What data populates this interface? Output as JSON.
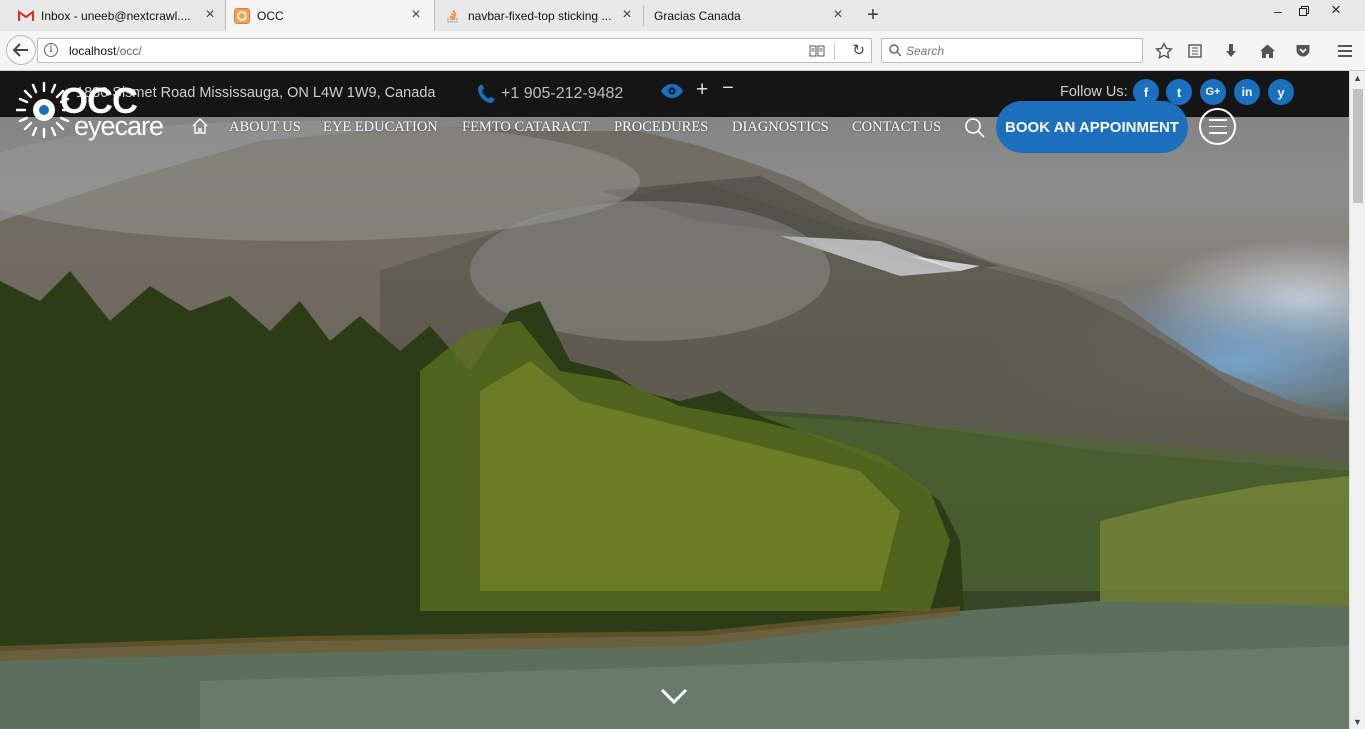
{
  "browser": {
    "tabs": [
      {
        "title": "Inbox - uneeb@nextcrawl....",
        "icon": "gmail-icon"
      },
      {
        "title": "OCC",
        "icon": "site-icon"
      },
      {
        "title": "navbar-fixed-top sticking ...",
        "icon": "stackoverflow-icon"
      },
      {
        "title": "Gracias Canada",
        "icon": "none"
      }
    ],
    "url_host": "localhost",
    "url_path": "/occ/",
    "search_placeholder": "Search"
  },
  "site": {
    "address": "1880 Sismet Road Mississauga, ON L4W 1W9, Canada",
    "phone": "+1 905-212-9482",
    "zoom_plus": "+",
    "zoom_minus": "−",
    "follow_label": "Follow Us:",
    "social": [
      {
        "name": "facebook",
        "glyph": "f"
      },
      {
        "name": "twitter",
        "glyph": "t"
      },
      {
        "name": "google-plus",
        "glyph": "G+"
      },
      {
        "name": "linkedin",
        "glyph": "in"
      },
      {
        "name": "yelp",
        "glyph": "y"
      }
    ],
    "logo_top": "OCC",
    "logo_bottom": "eyecare",
    "menu": [
      "ABOUT US",
      "EYE EDUCATION",
      "FEMTO CATARACT",
      "PROCEDURES",
      "DIAGNOSTICS",
      "CONTACT US"
    ],
    "book_button": "BOOK AN APPOINMENT",
    "accent_color": "#1b6fbd"
  }
}
